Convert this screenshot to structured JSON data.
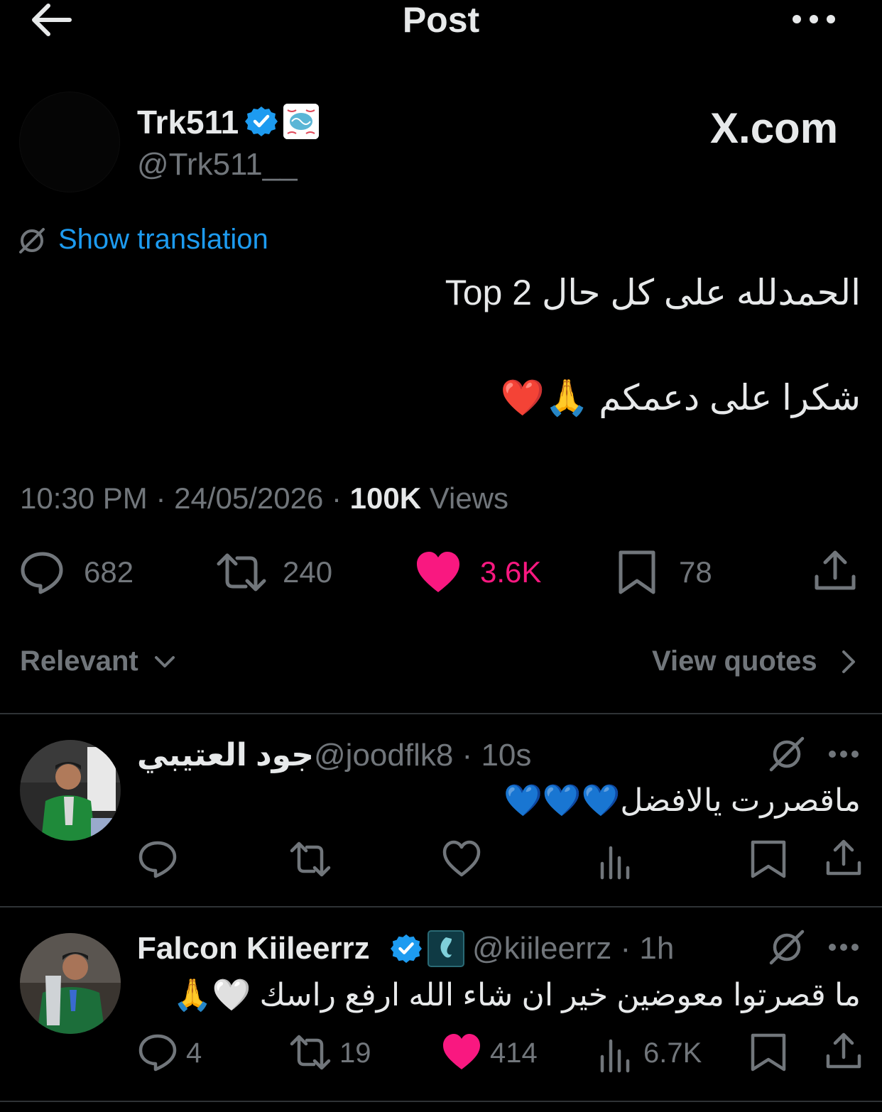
{
  "header": {
    "title": "Post"
  },
  "author": {
    "name": "Trk511",
    "handle": "@Trk511__"
  },
  "watermark": "X.com",
  "translation": {
    "label": "Show translation"
  },
  "tweet": {
    "line1": "الحمدلله على كل حال Top 2",
    "line2": "شكرا على دعمكم 🙏❤️"
  },
  "meta": {
    "time": "10:30 PM",
    "date": "24/05/2026",
    "views": "100K",
    "views_label": "Views"
  },
  "actions": {
    "replies": "682",
    "reposts": "240",
    "likes": "3.6K",
    "bookmarks": "78"
  },
  "sort": {
    "label": "Relevant",
    "quotes_label": "View quotes"
  },
  "replies": [
    {
      "name": "جود العتيبي",
      "handle": "@joodflk8",
      "time": "10s",
      "text": "ماقصررت يالافضل💙💙💙",
      "counts": {
        "replies": "",
        "reposts": "",
        "likes": "",
        "views": ""
      }
    },
    {
      "name": "Falcon Kiileerrz",
      "handle": "@kiileerrz",
      "time": "1h",
      "text": "ما قصرتوا معوضين خير ان شاء الله ارفع راسك 🤍🙏",
      "counts": {
        "replies": "4",
        "reposts": "19",
        "likes": "414",
        "views": "6.7K"
      }
    }
  ],
  "colors": {
    "accent": "#1d9bf0",
    "like": "#f91880",
    "muted": "#71767b",
    "text": "#e7e9ea",
    "divider": "#2f3336"
  }
}
